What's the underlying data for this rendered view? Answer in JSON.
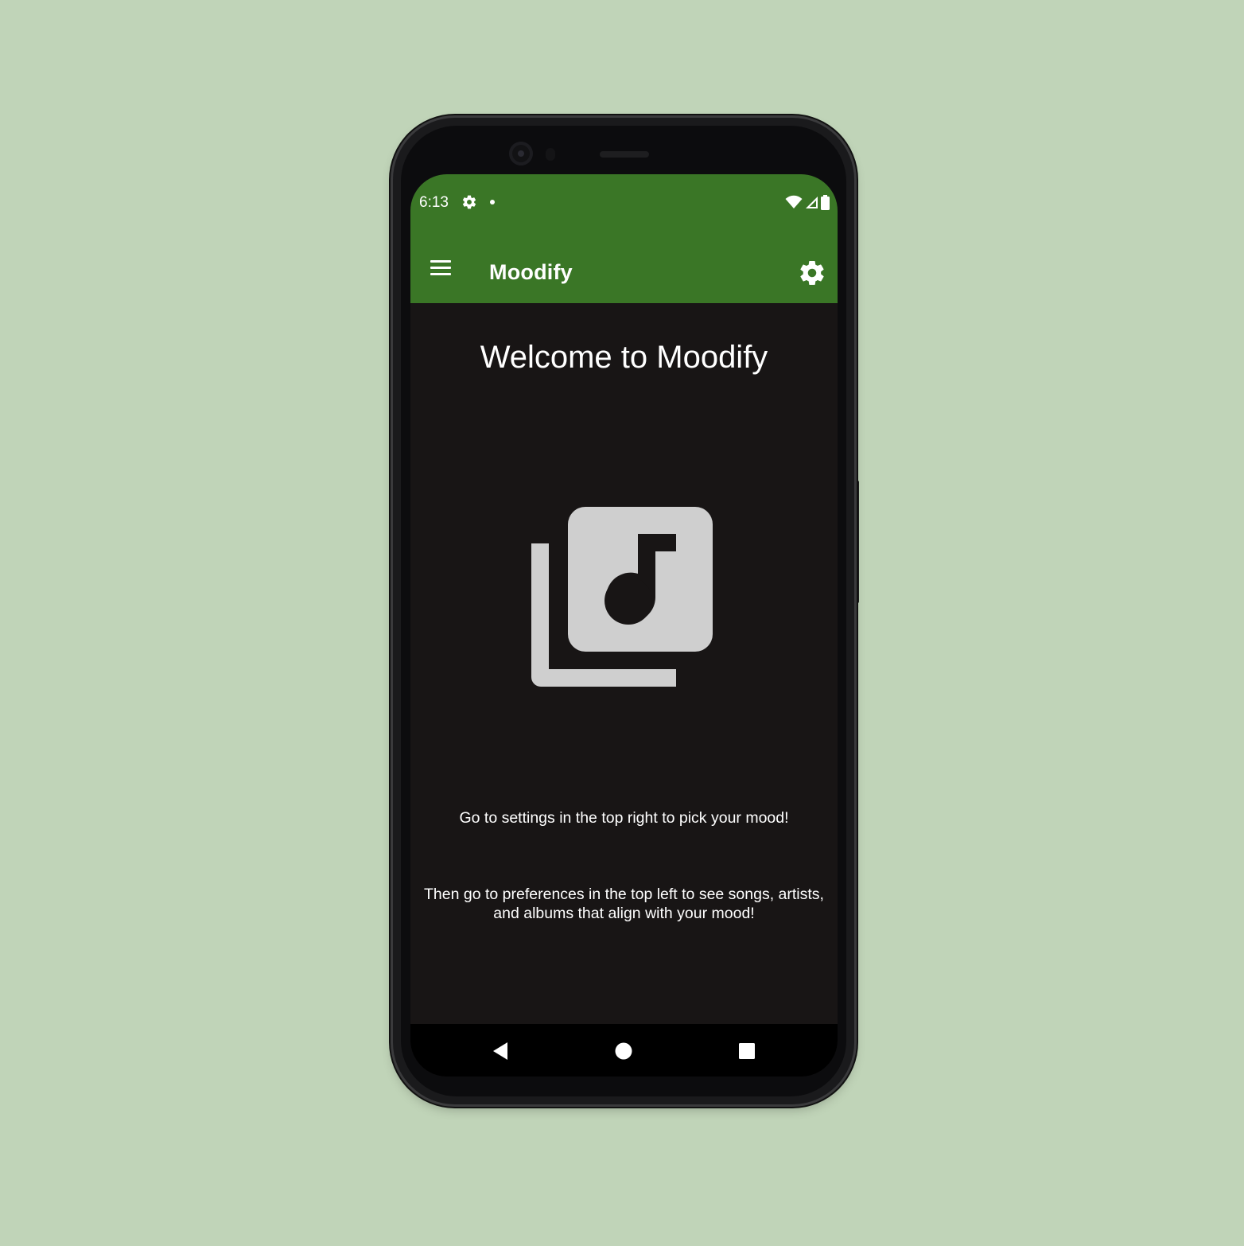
{
  "status_bar": {
    "time": "6:13",
    "icons": [
      "settings-gear-icon",
      "notification-dot-icon",
      "wifi-icon",
      "cell-signal-icon",
      "battery-icon"
    ]
  },
  "app_bar": {
    "title": "Moodify",
    "menu_icon": "hamburger-menu-icon",
    "settings_icon": "gear-icon",
    "background_color": "#3a7626"
  },
  "main": {
    "heading": "Welcome to Moodify",
    "illustration_icon": "music-library-icon",
    "instruction_1": "Go to settings in the top right to pick your mood!",
    "instruction_2": "Then go to preferences in the top left to see songs, artists, and albums that align with your mood!",
    "background_color": "#181515",
    "icon_color": "#cfcfcf"
  },
  "nav_bar": {
    "buttons": [
      "back-icon",
      "home-icon",
      "recents-icon"
    ]
  },
  "backdrop_color": "#c0d4b8"
}
